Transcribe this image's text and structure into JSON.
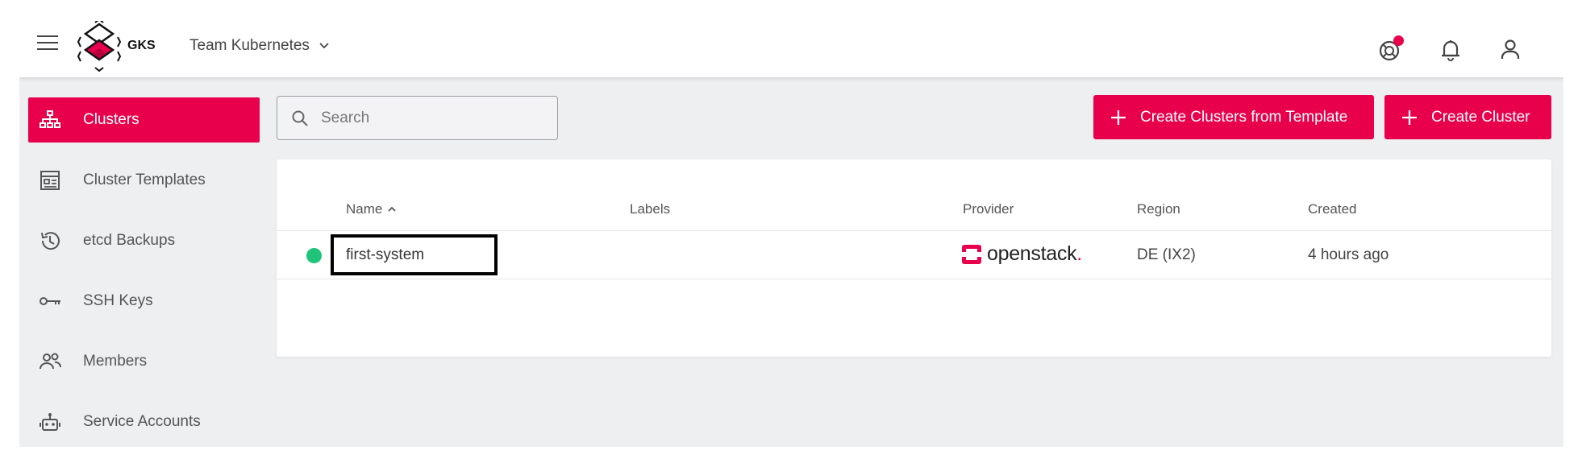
{
  "header": {
    "brand": "GKS",
    "project": "Team Kubernetes"
  },
  "sidebar": {
    "items": [
      {
        "label": "Clusters",
        "icon": "sitemap-icon",
        "active": true
      },
      {
        "label": "Cluster Templates",
        "icon": "template-icon",
        "active": false
      },
      {
        "label": "etcd Backups",
        "icon": "history-icon",
        "active": false
      },
      {
        "label": "SSH Keys",
        "icon": "key-icon",
        "active": false
      },
      {
        "label": "Members",
        "icon": "members-icon",
        "active": false
      },
      {
        "label": "Service Accounts",
        "icon": "robot-icon",
        "active": false
      }
    ]
  },
  "main": {
    "search": {
      "placeholder": "Search",
      "value": ""
    },
    "actions": {
      "create_from_template": "Create Clusters from Template",
      "create_cluster": "Create Cluster"
    },
    "table": {
      "columns": [
        "Name",
        "Labels",
        "Provider",
        "Region",
        "Created"
      ],
      "sorted_column": "Name",
      "sort_direction": "ascending",
      "rows": [
        {
          "status": "running",
          "name": "first-system",
          "labels": "",
          "provider": "openstack",
          "region": "DE (IX2)",
          "created": "4 hours ago"
        }
      ]
    }
  },
  "colors": {
    "accent": "#e8004c",
    "status_ok": "#1fc47a",
    "background": "#eeeff1"
  }
}
